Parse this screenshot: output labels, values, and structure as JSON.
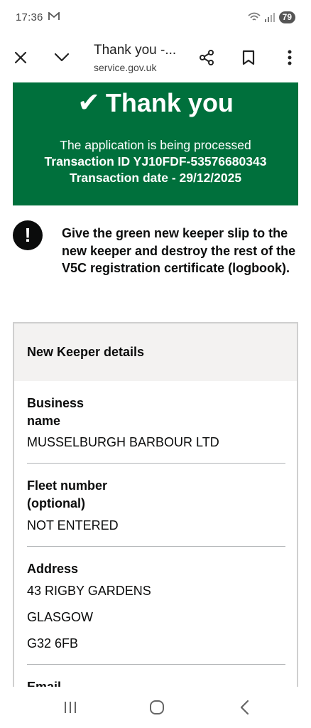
{
  "status_bar": {
    "time": "17:36",
    "notification_icon": "gmail-icon",
    "battery": "79"
  },
  "browser": {
    "tab_title": "Thank you -...",
    "url": "service.gov.uk",
    "icons": [
      "close-icon",
      "chevron-down-icon",
      "share-icon",
      "bookmark-icon",
      "more-vert-icon"
    ]
  },
  "confirmation": {
    "tick": "✔",
    "heading": "Thank you",
    "status": "The application is being processed",
    "transaction_id": "Transaction ID YJ10FDF-53576680343",
    "transaction_date": "Transaction date - 29/12/2025",
    "color": "#00703c"
  },
  "warning": {
    "icon": "!",
    "text": "Give the green new keeper slip to the new keeper and destroy the rest of the V5C registration certificate (logbook)."
  },
  "new_keeper": {
    "title": "New Keeper details",
    "business_name_label": "Business name",
    "business_name": "MUSSELBURGH BARBOUR LTD",
    "fleet_label": "Fleet number (optional)",
    "fleet_value": "NOT ENTERED",
    "address_label": "Address",
    "address_line1": "43 RIGBY GARDENS",
    "address_line2": "GLASGOW",
    "address_line3": "G32 6FB",
    "email_label": "Email"
  }
}
